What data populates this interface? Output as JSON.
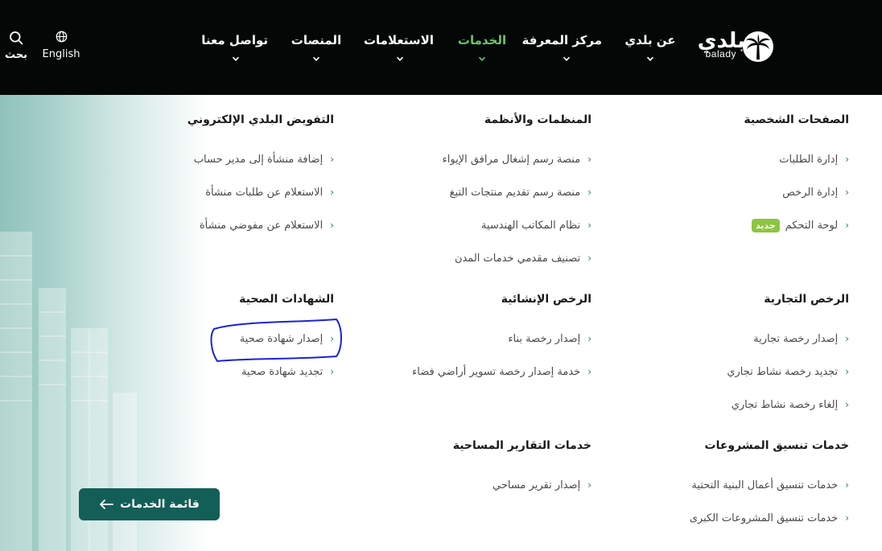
{
  "header": {
    "logo_text_ar": "بلدي",
    "logo_text_en": "balady",
    "nav": [
      {
        "label": "عن بلدي",
        "active": false
      },
      {
        "label": "مركز المعرفة",
        "active": false
      },
      {
        "label": "الخدمات",
        "active": true
      },
      {
        "label": "الاستعلامات",
        "active": false
      },
      {
        "label": "المنصات",
        "active": false
      },
      {
        "label": "تواصل معنا",
        "active": false
      }
    ],
    "language_label": "English",
    "search_label": "بحث",
    "active_color": "#6ec36a"
  },
  "sections": [
    {
      "title": "الصفحات الشخصية",
      "links": [
        {
          "label": "إدارة الطلبات"
        },
        {
          "label": "إدارة الرخص"
        },
        {
          "label": "لوحة التحكم",
          "badge": "جديد"
        }
      ]
    },
    {
      "title": "المنظمات والأنظمة",
      "links": [
        {
          "label": "منصة رسم إشغال مرافق الإيواء"
        },
        {
          "label": "منصة رسم تقديم منتجات التبغ"
        },
        {
          "label": "نظام المكاتب الهندسية"
        },
        {
          "label": "تصنيف مقدمي خدمات المدن"
        }
      ]
    },
    {
      "title": "التفويض البلدي الإلكتروني",
      "links": [
        {
          "label": "إضافة منشأة إلى مدير حساب"
        },
        {
          "label": "الاستعلام عن طلبات منشأة"
        },
        {
          "label": "الاستعلام عن مفوضي منشأة"
        }
      ]
    },
    {
      "title": "الرخص التجارية",
      "links": [
        {
          "label": "إصدار رخصة تجارية"
        },
        {
          "label": "تجديد رخصة نشاط تجاري"
        },
        {
          "label": "إلغاء رخصة نشاط تجاري"
        }
      ]
    },
    {
      "title": "الرخص الإنشائية",
      "links": [
        {
          "label": "إصدار رخصة بناء"
        },
        {
          "label": "خدمة إصدار رخصة تسوير أراضي فضاء"
        }
      ]
    },
    {
      "title": "الشهادات الصحية",
      "links": [
        {
          "label": "إصدار شهادة صحية"
        },
        {
          "label": "تجديد شهادة صحية"
        }
      ]
    },
    {
      "title": "خدمات تنسيق المشروعات",
      "links": [
        {
          "label": "خدمات تنسيق أعمال البنية التحتية"
        },
        {
          "label": "خدمات تنسيق المشروعات الكبرى"
        }
      ]
    },
    {
      "title": "خدمات التقارير المساحية",
      "links": [
        {
          "label": "إصدار تقرير مساحي"
        }
      ]
    }
  ],
  "services_button": {
    "label": "قائمة الخدمات",
    "color": "#135f58"
  },
  "annotation_color": "#1a23d6"
}
